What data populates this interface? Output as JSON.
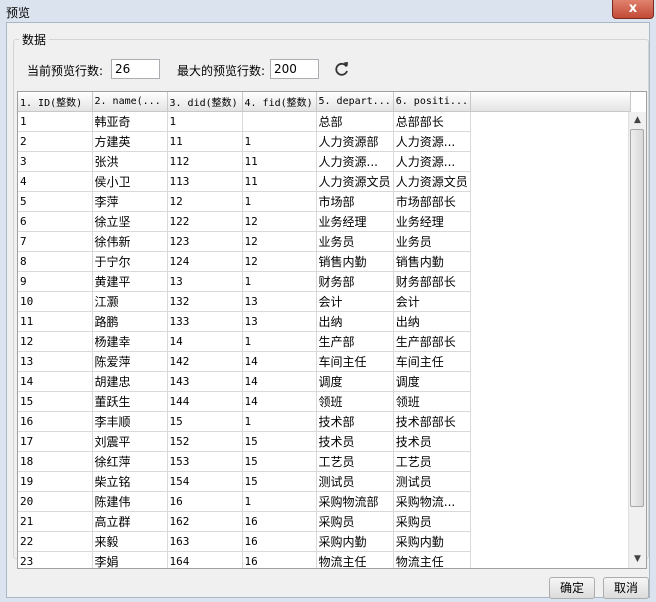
{
  "window": {
    "title": "预览",
    "close_glyph": "x"
  },
  "group": {
    "label": "数据"
  },
  "toolbar": {
    "current_rows_label": "当前预览行数:",
    "current_rows_value": "26",
    "max_rows_label": "最大的预览行数:",
    "max_rows_value": "200",
    "refresh_icon": "refresh-icon"
  },
  "table": {
    "columns": [
      "1. ID(整数)",
      "2. name(...",
      "3. did(整数)",
      "4. fid(整数)",
      "5. depart...",
      "6. positi..."
    ],
    "rows": [
      [
        "1",
        "韩亚奇",
        "1",
        "",
        "总部",
        "总部部长"
      ],
      [
        "2",
        "方建英",
        "11",
        "1",
        "人力资源部",
        "人力资源..."
      ],
      [
        "3",
        "张洪",
        "112",
        "11",
        "人力资源...",
        "人力资源..."
      ],
      [
        "4",
        "侯小卫",
        "113",
        "11",
        "人力资源文员",
        "人力资源文员"
      ],
      [
        "5",
        "李萍",
        "12",
        "1",
        "市场部",
        "市场部部长"
      ],
      [
        "6",
        "徐立坚",
        "122",
        "12",
        "业务经理",
        "业务经理"
      ],
      [
        "7",
        "徐伟新",
        "123",
        "12",
        "业务员",
        "业务员"
      ],
      [
        "8",
        "于宁尔",
        "124",
        "12",
        "销售内勤",
        "销售内勤"
      ],
      [
        "9",
        "黄建平",
        "13",
        "1",
        "财务部",
        "财务部部长"
      ],
      [
        "10",
        "江灏",
        "132",
        "13",
        "会计",
        "会计"
      ],
      [
        "11",
        "路鹏",
        "133",
        "13",
        "出纳",
        "出纳"
      ],
      [
        "12",
        "杨建幸",
        "14",
        "1",
        "生产部",
        "生产部部长"
      ],
      [
        "13",
        "陈爱萍",
        "142",
        "14",
        "车间主任",
        "车间主任"
      ],
      [
        "14",
        "胡建忠",
        "143",
        "14",
        "调度",
        "调度"
      ],
      [
        "15",
        "董跃生",
        "144",
        "14",
        "领班",
        "领班"
      ],
      [
        "16",
        "李丰顺",
        "15",
        "1",
        "技术部",
        "技术部部长"
      ],
      [
        "17",
        "刘震平",
        "152",
        "15",
        "技术员",
        "技术员"
      ],
      [
        "18",
        "徐红萍",
        "153",
        "15",
        "工艺员",
        "工艺员"
      ],
      [
        "19",
        "柴立铭",
        "154",
        "15",
        "测试员",
        "测试员"
      ],
      [
        "20",
        "陈建伟",
        "16",
        "1",
        "采购物流部",
        "采购物流..."
      ],
      [
        "21",
        "高立群",
        "162",
        "16",
        "采购员",
        "采购员"
      ],
      [
        "22",
        "来毅",
        "163",
        "16",
        "采购内勤",
        "采购内勤"
      ],
      [
        "23",
        "李娟",
        "164",
        "16",
        "物流主任",
        "物流主任"
      ]
    ]
  },
  "buttons": {
    "ok": "确定",
    "cancel": "取消"
  }
}
